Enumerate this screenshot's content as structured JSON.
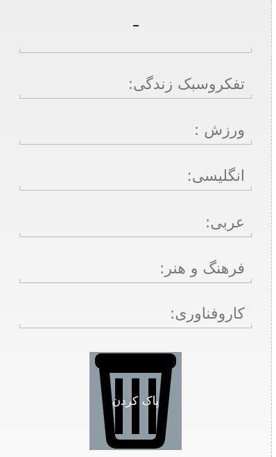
{
  "form": {
    "fields": [
      {
        "label": "تفکروسبک زندگی:"
      },
      {
        "label": "ورزش :"
      },
      {
        "label": "انگلیسی:"
      },
      {
        "label": "عربی:"
      },
      {
        "label": "فرهنگ و هنر:"
      },
      {
        "label": "کاروفناوری:"
      }
    ]
  },
  "actions": {
    "clear_label": "پاک کردن",
    "clear_icon": "trash-icon"
  },
  "colors": {
    "button_bg": "#8d9da3",
    "label_text": "#777777"
  }
}
